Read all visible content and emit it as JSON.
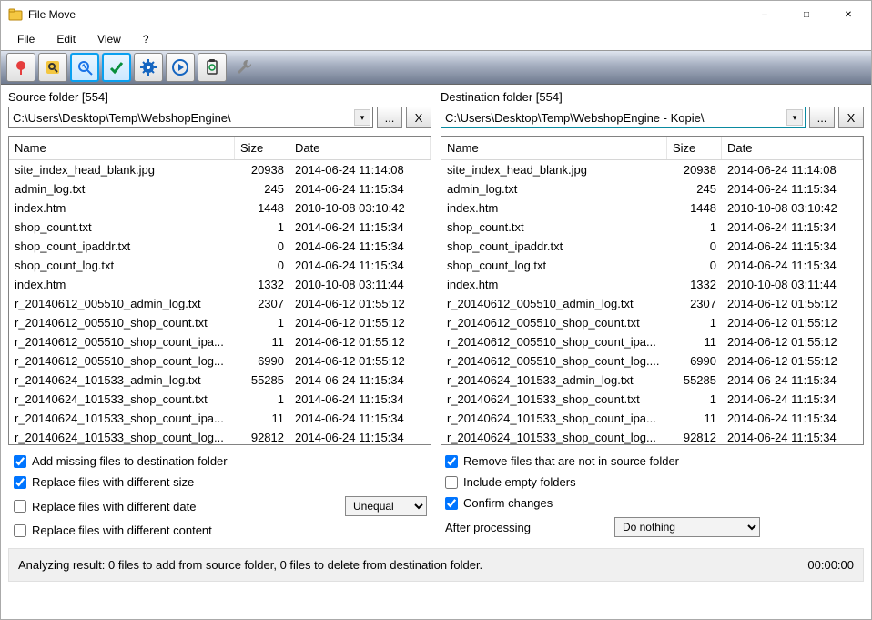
{
  "titlebar": {
    "title": "File Move"
  },
  "menu": {
    "file": "File",
    "edit": "Edit",
    "view": "View",
    "help": "?"
  },
  "source": {
    "label": "Source folder [554]",
    "path": "C:\\Users\\Desktop\\Temp\\WebshopEngine\\",
    "browse": "...",
    "clear": "X",
    "cols": {
      "name": "Name",
      "size": "Size",
      "date": "Date"
    },
    "rows": [
      {
        "name": "site_index_head_blank.jpg",
        "size": "20938",
        "date": "2014-06-24 11:14:08"
      },
      {
        "name": "admin_log.txt",
        "size": "245",
        "date": "2014-06-24 11:15:34"
      },
      {
        "name": "index.htm",
        "size": "1448",
        "date": "2010-10-08 03:10:42"
      },
      {
        "name": "shop_count.txt",
        "size": "1",
        "date": "2014-06-24 11:15:34"
      },
      {
        "name": "shop_count_ipaddr.txt",
        "size": "0",
        "date": "2014-06-24 11:15:34"
      },
      {
        "name": "shop_count_log.txt",
        "size": "0",
        "date": "2014-06-24 11:15:34"
      },
      {
        "name": "index.htm",
        "size": "1332",
        "date": "2010-10-08 03:11:44"
      },
      {
        "name": "r_20140612_005510_admin_log.txt",
        "size": "2307",
        "date": "2014-06-12 01:55:12"
      },
      {
        "name": "r_20140612_005510_shop_count.txt",
        "size": "1",
        "date": "2014-06-12 01:55:12"
      },
      {
        "name": "r_20140612_005510_shop_count_ipa...",
        "size": "11",
        "date": "2014-06-12 01:55:12"
      },
      {
        "name": "r_20140612_005510_shop_count_log...",
        "size": "6990",
        "date": "2014-06-12 01:55:12"
      },
      {
        "name": "r_20140624_101533_admin_log.txt",
        "size": "55285",
        "date": "2014-06-24 11:15:34"
      },
      {
        "name": "r_20140624_101533_shop_count.txt",
        "size": "1",
        "date": "2014-06-24 11:15:34"
      },
      {
        "name": "r_20140624_101533_shop_count_ipa...",
        "size": "11",
        "date": "2014-06-24 11:15:34"
      },
      {
        "name": "r_20140624_101533_shop_count_log...",
        "size": "92812",
        "date": "2014-06-24 11:15:34"
      }
    ]
  },
  "dest": {
    "label": "Destination folder [554]",
    "path": "C:\\Users\\Desktop\\Temp\\WebshopEngine - Kopie\\",
    "browse": "...",
    "clear": "X",
    "cols": {
      "name": "Name",
      "size": "Size",
      "date": "Date"
    },
    "rows": [
      {
        "name": "site_index_head_blank.jpg",
        "size": "20938",
        "date": "2014-06-24 11:14:08"
      },
      {
        "name": "admin_log.txt",
        "size": "245",
        "date": "2014-06-24 11:15:34"
      },
      {
        "name": "index.htm",
        "size": "1448",
        "date": "2010-10-08 03:10:42"
      },
      {
        "name": "shop_count.txt",
        "size": "1",
        "date": "2014-06-24 11:15:34"
      },
      {
        "name": "shop_count_ipaddr.txt",
        "size": "0",
        "date": "2014-06-24 11:15:34"
      },
      {
        "name": "shop_count_log.txt",
        "size": "0",
        "date": "2014-06-24 11:15:34"
      },
      {
        "name": "index.htm",
        "size": "1332",
        "date": "2010-10-08 03:11:44"
      },
      {
        "name": "r_20140612_005510_admin_log.txt",
        "size": "2307",
        "date": "2014-06-12 01:55:12"
      },
      {
        "name": "r_20140612_005510_shop_count.txt",
        "size": "1",
        "date": "2014-06-12 01:55:12"
      },
      {
        "name": "r_20140612_005510_shop_count_ipa...",
        "size": "11",
        "date": "2014-06-12 01:55:12"
      },
      {
        "name": "r_20140612_005510_shop_count_log....",
        "size": "6990",
        "date": "2014-06-12 01:55:12"
      },
      {
        "name": "r_20140624_101533_admin_log.txt",
        "size": "55285",
        "date": "2014-06-24 11:15:34"
      },
      {
        "name": "r_20140624_101533_shop_count.txt",
        "size": "1",
        "date": "2014-06-24 11:15:34"
      },
      {
        "name": "r_20140624_101533_shop_count_ipa...",
        "size": "11",
        "date": "2014-06-24 11:15:34"
      },
      {
        "name": "r_20140624_101533_shop_count_log...",
        "size": "92812",
        "date": "2014-06-24 11:15:34"
      }
    ]
  },
  "options": {
    "add_missing": "Add missing files to destination folder",
    "replace_size": "Replace files with different size",
    "replace_date": "Replace files with different date",
    "replace_content": "Replace files with different content",
    "remove_not_in_source": "Remove files that are not in source folder",
    "include_empty": "Include empty folders",
    "confirm": "Confirm changes",
    "after_processing_label": "After processing",
    "date_compare": "Unequal",
    "after_processing": "Do nothing"
  },
  "status": {
    "text": "Analyzing result: 0 files to add from source folder, 0 files to delete from destination folder.",
    "time": "00:00:00"
  }
}
